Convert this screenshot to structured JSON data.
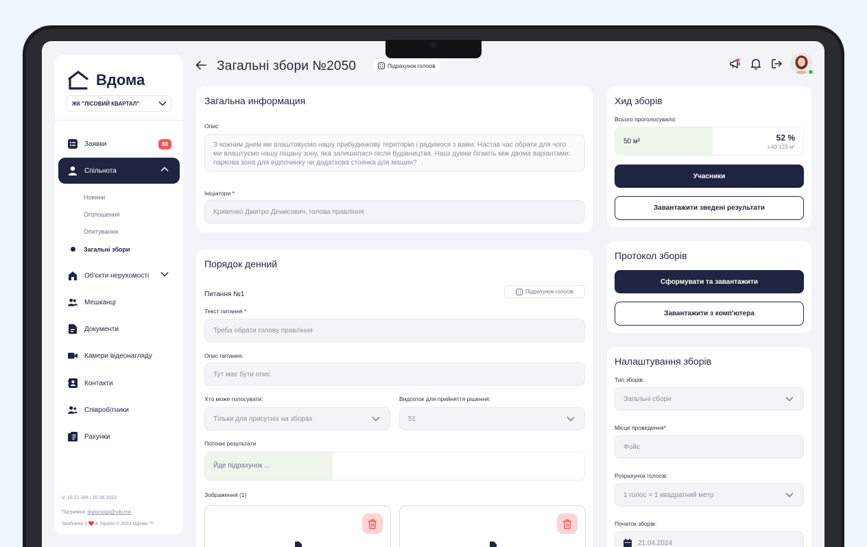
{
  "sidebar": {
    "logo_text": "Вдома",
    "complex": "ЖК \"ЛІСОВИЙ КВАРТАЛ\"",
    "items": [
      {
        "label": "Заявки",
        "icon": "requests-icon",
        "badge": "88"
      },
      {
        "label": "Спільнота",
        "icon": "user-icon"
      },
      {
        "label": "Об'єкти нерухомості",
        "icon": "house-icon"
      },
      {
        "label": "Мешканці",
        "icon": "people-icon"
      },
      {
        "label": "Документи",
        "icon": "document-icon"
      },
      {
        "label": "Камери відеонагляду",
        "icon": "camera-icon"
      },
      {
        "label": "Контакти",
        "icon": "contacts-icon"
      },
      {
        "label": "Співробітники",
        "icon": "staff-icon"
      },
      {
        "label": "Рахунки",
        "icon": "invoice-icon"
      }
    ],
    "subitems": [
      "Новини",
      "Оголошення",
      "Опитування",
      "Загальні збори"
    ],
    "version": "V. 10.22.345 / 20.08.2023",
    "support_prefix": "Підтримка: ",
    "support_email": "dopomoga@vdo.ma",
    "made_in": "Зроблено з ❤️ в Україні © 2024 Вдома ™"
  },
  "header": {
    "title": "Загальні збори №2050",
    "chip": "Підрахунок голосів"
  },
  "general": {
    "title": "Загальна информация",
    "desc_label": "Опис",
    "desc_value": "З кожним днем ми влаштовуємо нашу прибудинкову територію і радимося з вами. Настав час обрати для чого ми влаштуємо нашу піщану зону, яка залишилася після будівництва. Наші думки бігають між двома варіантами: паркова зона для відпочинку чи додаткова стоянка для машин?",
    "initiators_label": "Ініціатори *",
    "initiators_value": "Кривенко Дмитро Денисович, голова правління"
  },
  "agenda": {
    "title": "Порядок денний",
    "question_title": "Питання №1",
    "count_button": "Підрахунок голосів",
    "text_label": "Текст питання *",
    "text_value": "Треба обрати голову правління",
    "desc_label": "Опис питання:",
    "desc_value": "Тут має бути опис",
    "who_label": "Хто може голосувати:",
    "who_value": "Тільки для присутніх на зборах",
    "percent_label": "Видсоток для прийняття рішення:",
    "percent_value": "51",
    "results_label": "Поточні результати",
    "results_value": "Йде підрахунок ...",
    "images_label": "Зображення (1)"
  },
  "progress": {
    "title": "Хид зборів",
    "total_label": "Всього проголосувало:",
    "voted_area": "50 м²",
    "percent": "52 %",
    "total_area": "з 40 123 м²",
    "fill_fraction": 0.52,
    "participants_button": "Учасники",
    "download_button": "Завантажити зведені результати"
  },
  "protocol": {
    "title": "Протокол зборів",
    "generate_button": "Сформувати та завантажити",
    "upload_button": "Завантажити з комп'ютера"
  },
  "settings": {
    "title": "Налаштування зборів",
    "type_label": "Тип зборів:",
    "type_value": "Загальні сбори",
    "place_label": "Місце проведення*",
    "place_value": "Фойє",
    "calc_label": "Розрахунок голосів:",
    "calc_value": "1 голос = 1 квадратний метр",
    "start_label": "Початок зборів:",
    "start_value": "21.04.2024"
  },
  "colors": {
    "primary": "#1f2540",
    "badge": "#f25656",
    "progress_fill": "#eef6ec",
    "trash_bg": "#fcd4d4",
    "online": "#2fbf5a"
  }
}
